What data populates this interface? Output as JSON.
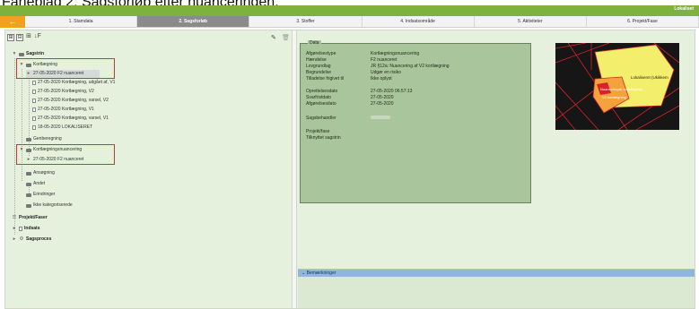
{
  "caption": "Faneblad 2: Sagsforløb efter nuanceringen.",
  "brand": "Lokaliset",
  "tabs": {
    "back": "←",
    "items": [
      "1. Stamdata",
      "2. Sagsforløb",
      "3. Stoffer",
      "4. Indsatsområde",
      "5. Aktiviteter",
      "6. Projekt/Fase"
    ]
  },
  "toolbar": {
    "expand": "⊞",
    "collapse": "⊟",
    "tree_icon": "⊞",
    "sort": "↓F"
  },
  "tree": {
    "sagstrin": "Sagstrin",
    "kortlaegning": "Kortlægning",
    "item_selected": "27-05-2020 F2 nuanceret",
    "k_items": [
      "27-05-2020 Kortlægning, udgået af, V1",
      "27-05-2020 Kortlægning, V2",
      "27-05-2020 Kortlægning, varsel, V2",
      "27-05-2020 Kortlægning, V1",
      "27-05-2020 Kortlægning, varsel, V1",
      "18-05-2020 LOKALISERET"
    ],
    "genberegning": "Genberegning",
    "kortnuancering": "Kortlægningsnuancering",
    "kn_item": "27-05-2020 F2 nuanceret",
    "ansoegning": "Ansøgning",
    "andet": "Andet",
    "erindringer": "Erindringer",
    "ikke_kat": "Ikke kategoriserede",
    "projekt_faser": "Projekt/Faser",
    "indsats": "Indsats",
    "sagsproces": "Sagsproces"
  },
  "data": {
    "legend": "Data",
    "fields": [
      {
        "label": "Afgørelsestype",
        "value": "Kortlægningsnuancering"
      },
      {
        "label": "Hændelse",
        "value": "F2 nuanceret"
      },
      {
        "label": "Lovgrundlag",
        "value": "JR §12a: Nuancering af V2 kortlægning"
      },
      {
        "label": "Begrundelse",
        "value": "Udgør en risiko"
      },
      {
        "label": "Tilladelse frigivet til",
        "value": "Ikke oplyst"
      }
    ],
    "dates": [
      {
        "label": "Oprettelsesdato",
        "value": "27-05-2020 06:57:13"
      },
      {
        "label": "Svarfristdato",
        "value": "27-05-2020"
      },
      {
        "label": "Afgørelsesdato",
        "value": "27-05-2020"
      }
    ],
    "sagsbehandler": "Sagsbehandler",
    "projekt_fase": "Projekt/fase",
    "tilknyttet": "Tilknyttet sagstrin"
  },
  "map": {
    "label1": "Lokaliseret (Ukikkem",
    "label2": "Nuanceringsk kortlægning",
    "label3": "V2 kortlægning"
  },
  "remarks": {
    "title": "Bemærkninger",
    "chevron": "⌄"
  },
  "colors": {
    "topbar": "#7fb13f",
    "back_tab": "#f0a21f",
    "active_tab": "#8b8b8b",
    "panel": "#a9c59b",
    "highlight": "#d9342b"
  }
}
